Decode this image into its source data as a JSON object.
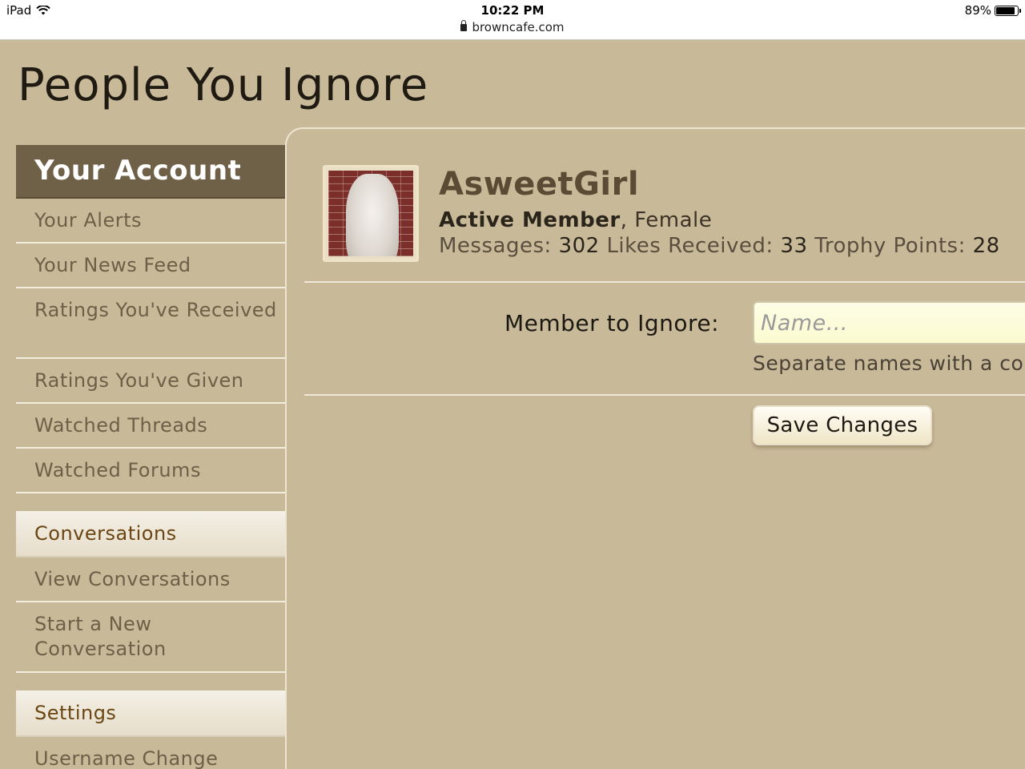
{
  "status_bar": {
    "device": "iPad",
    "time": "10:22 PM",
    "url": "browncafe.com",
    "battery_percent": "89%",
    "battery_level": 0.89
  },
  "page": {
    "title": "People You Ignore"
  },
  "sidebar": {
    "header": "Your Account",
    "account_items": [
      {
        "label": "Your Alerts"
      },
      {
        "label": "Your News Feed"
      },
      {
        "label": "Ratings You've Received"
      },
      {
        "label": "Ratings You've Given"
      },
      {
        "label": "Watched Threads"
      },
      {
        "label": "Watched Forums"
      }
    ],
    "conversations": {
      "header": "Conversations",
      "items": [
        {
          "label": "View Conversations"
        },
        {
          "label": "Start a New Conversation"
        }
      ]
    },
    "settings": {
      "header": "Settings",
      "items": [
        {
          "label": "Username Change"
        }
      ]
    }
  },
  "profile": {
    "username": "AsweetGirl",
    "title": "Active Member",
    "gender": ", Female",
    "messages_label": "Messages:",
    "messages": "302",
    "likes_label": "Likes Received:",
    "likes": "33",
    "trophy_label": "Trophy Points:",
    "trophy": "28"
  },
  "form": {
    "label": "Member to Ignore:",
    "placeholder": "Name…",
    "hint": "Separate names with a com",
    "save_label": "Save Changes"
  }
}
